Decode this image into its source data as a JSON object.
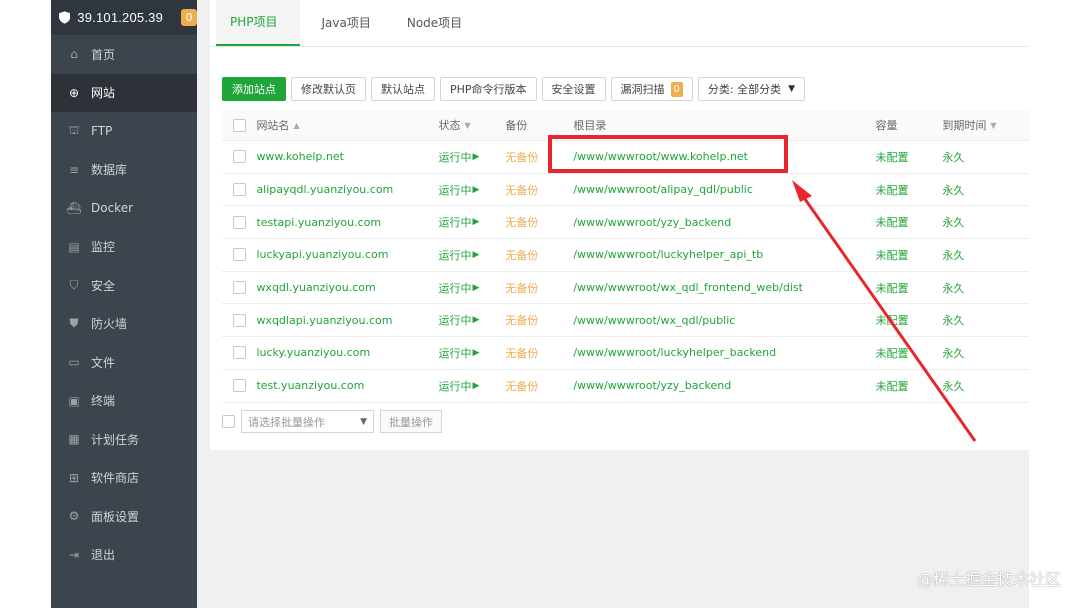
{
  "sidebar": {
    "server_ip": "39.101.205.39",
    "alert_count": "0",
    "items": [
      {
        "label": "首页",
        "icon": "home-icon",
        "active": false
      },
      {
        "label": "网站",
        "icon": "globe-icon",
        "active": true
      },
      {
        "label": "FTP",
        "icon": "ftp-icon",
        "active": false
      },
      {
        "label": "数据库",
        "icon": "database-icon",
        "active": false
      },
      {
        "label": "Docker",
        "icon": "docker-icon",
        "active": false
      },
      {
        "label": "监控",
        "icon": "monitor-icon",
        "active": false
      },
      {
        "label": "安全",
        "icon": "security-icon",
        "active": false
      },
      {
        "label": "防火墙",
        "icon": "firewall-icon",
        "active": false
      },
      {
        "label": "文件",
        "icon": "folder-icon",
        "active": false
      },
      {
        "label": "终端",
        "icon": "terminal-icon",
        "active": false
      },
      {
        "label": "计划任务",
        "icon": "calendar-icon",
        "active": false
      },
      {
        "label": "软件商店",
        "icon": "apps-icon",
        "active": false
      },
      {
        "label": "面板设置",
        "icon": "gear-icon",
        "active": false
      },
      {
        "label": "退出",
        "icon": "logout-icon",
        "active": false
      }
    ]
  },
  "tabs": [
    {
      "label": "PHP项目",
      "active": true
    },
    {
      "label": "Java项目",
      "active": false
    },
    {
      "label": "Node项目",
      "active": false
    }
  ],
  "toolbar": {
    "add_site": "添加站点",
    "modify_default_page": "修改默认页",
    "default_site": "默认站点",
    "php_cli_version": "PHP命令行版本",
    "security_settings": "安全设置",
    "vuln_scan": "漏洞扫描",
    "vuln_count": "0",
    "category_filter": "分类: 全部分类"
  },
  "table": {
    "columns": [
      "网站名",
      "状态",
      "备份",
      "根目录",
      "容量",
      "到期时间"
    ],
    "rows": [
      {
        "name": "www.kohelp.net",
        "status": "运行中",
        "backup": "无备份",
        "path": "/www/wwwroot/www.kohelp.net",
        "capacity": "未配置",
        "expires": "永久"
      },
      {
        "name": "alipayqdl.yuanziyou.com",
        "status": "运行中",
        "backup": "无备份",
        "path": "/www/wwwroot/alipay_qdl/public",
        "capacity": "未配置",
        "expires": "永久"
      },
      {
        "name": "testapi.yuanziyou.com",
        "status": "运行中",
        "backup": "无备份",
        "path": "/www/wwwroot/yzy_backend",
        "capacity": "未配置",
        "expires": "永久"
      },
      {
        "name": "luckyapi.yuanziyou.com",
        "status": "运行中",
        "backup": "无备份",
        "path": "/www/wwwroot/luckyhelper_api_tb",
        "capacity": "未配置",
        "expires": "永久"
      },
      {
        "name": "wxqdl.yuanziyou.com",
        "status": "运行中",
        "backup": "无备份",
        "path": "/www/wwwroot/wx_qdl_frontend_web/dist",
        "capacity": "未配置",
        "expires": "永久"
      },
      {
        "name": "wxqdlapi.yuanziyou.com",
        "status": "运行中",
        "backup": "无备份",
        "path": "/www/wwwroot/wx_qdl/public",
        "capacity": "未配置",
        "expires": "永久"
      },
      {
        "name": "lucky.yuanziyou.com",
        "status": "运行中",
        "backup": "无备份",
        "path": "/www/wwwroot/luckyhelper_backend",
        "capacity": "未配置",
        "expires": "永久"
      },
      {
        "name": "test.yuanziyou.com",
        "status": "运行中",
        "backup": "无备份",
        "path": "/www/wwwroot/yzy_backend",
        "capacity": "未配置",
        "expires": "永久"
      }
    ]
  },
  "bulk": {
    "select_placeholder": "请选择批量操作",
    "action": "批量操作"
  },
  "watermark": "@稀土掘金技术社区",
  "colors": {
    "accent": "#20a53a",
    "warning": "#f0ad4e",
    "annotation": "#e8262d",
    "sidebar_bg": "#3c444d"
  }
}
